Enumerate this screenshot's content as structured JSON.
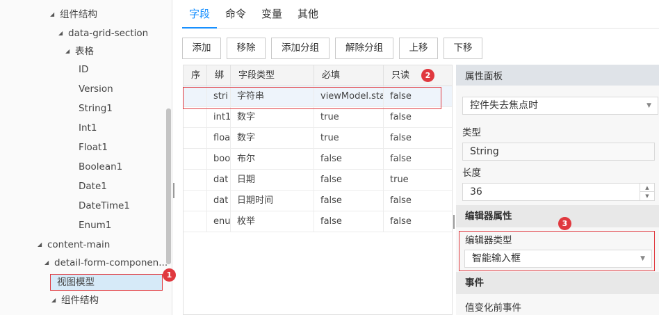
{
  "tree": {
    "items": [
      {
        "label": "组件结构",
        "expanded": true
      },
      {
        "label": "data-grid-section",
        "expanded": true
      },
      {
        "label": "表格",
        "expanded": true
      },
      {
        "label": "ID"
      },
      {
        "label": "Version"
      },
      {
        "label": "String1"
      },
      {
        "label": "Int1"
      },
      {
        "label": "Float1"
      },
      {
        "label": "Boolean1"
      },
      {
        "label": "Date1"
      },
      {
        "label": "DateTime1"
      },
      {
        "label": "Enum1"
      },
      {
        "label": "content-main",
        "expanded": true
      },
      {
        "label": "detail-form-componen...",
        "expanded": true
      },
      {
        "label": "视图模型",
        "selected": true
      },
      {
        "label": "组件结构",
        "expanded": true
      }
    ]
  },
  "tabs": [
    "字段",
    "命令",
    "变量",
    "其他"
  ],
  "toolbar": {
    "add": "添加",
    "remove": "移除",
    "add_group": "添加分组",
    "ungroup": "解除分组",
    "move_up": "上移",
    "move_down": "下移"
  },
  "grid": {
    "headers": [
      "序",
      "绑",
      "字段类型",
      "必填",
      "只读"
    ],
    "rows": [
      [
        "",
        "stri",
        "字符串",
        "viewModel.sta",
        "false"
      ],
      [
        "",
        "int1",
        "数字",
        "true",
        "false"
      ],
      [
        "",
        "floa",
        "数字",
        "true",
        "false"
      ],
      [
        "",
        "boo",
        "布尔",
        "false",
        "false"
      ],
      [
        "",
        "dat",
        "日期",
        "false",
        "true"
      ],
      [
        "",
        "dat",
        "日期时间",
        "false",
        "false"
      ],
      [
        "",
        "enu",
        "枚举",
        "false",
        "false"
      ]
    ]
  },
  "props": {
    "title": "属性面板",
    "update_mode_value": "控件失去焦点时",
    "type_label": "类型",
    "type_value": "String",
    "length_label": "长度",
    "length_value": "36",
    "editor_section": "编辑器属性",
    "editor_type_label": "编辑器类型",
    "editor_type_value": "智能输入框",
    "events_section": "事件",
    "before_change_event": "值变化前事件"
  },
  "badges": [
    "1",
    "2",
    "3"
  ],
  "colors": {
    "accent": "#1890ff",
    "highlight": "#e0383e",
    "selected_bg": "#d6eaf8"
  }
}
